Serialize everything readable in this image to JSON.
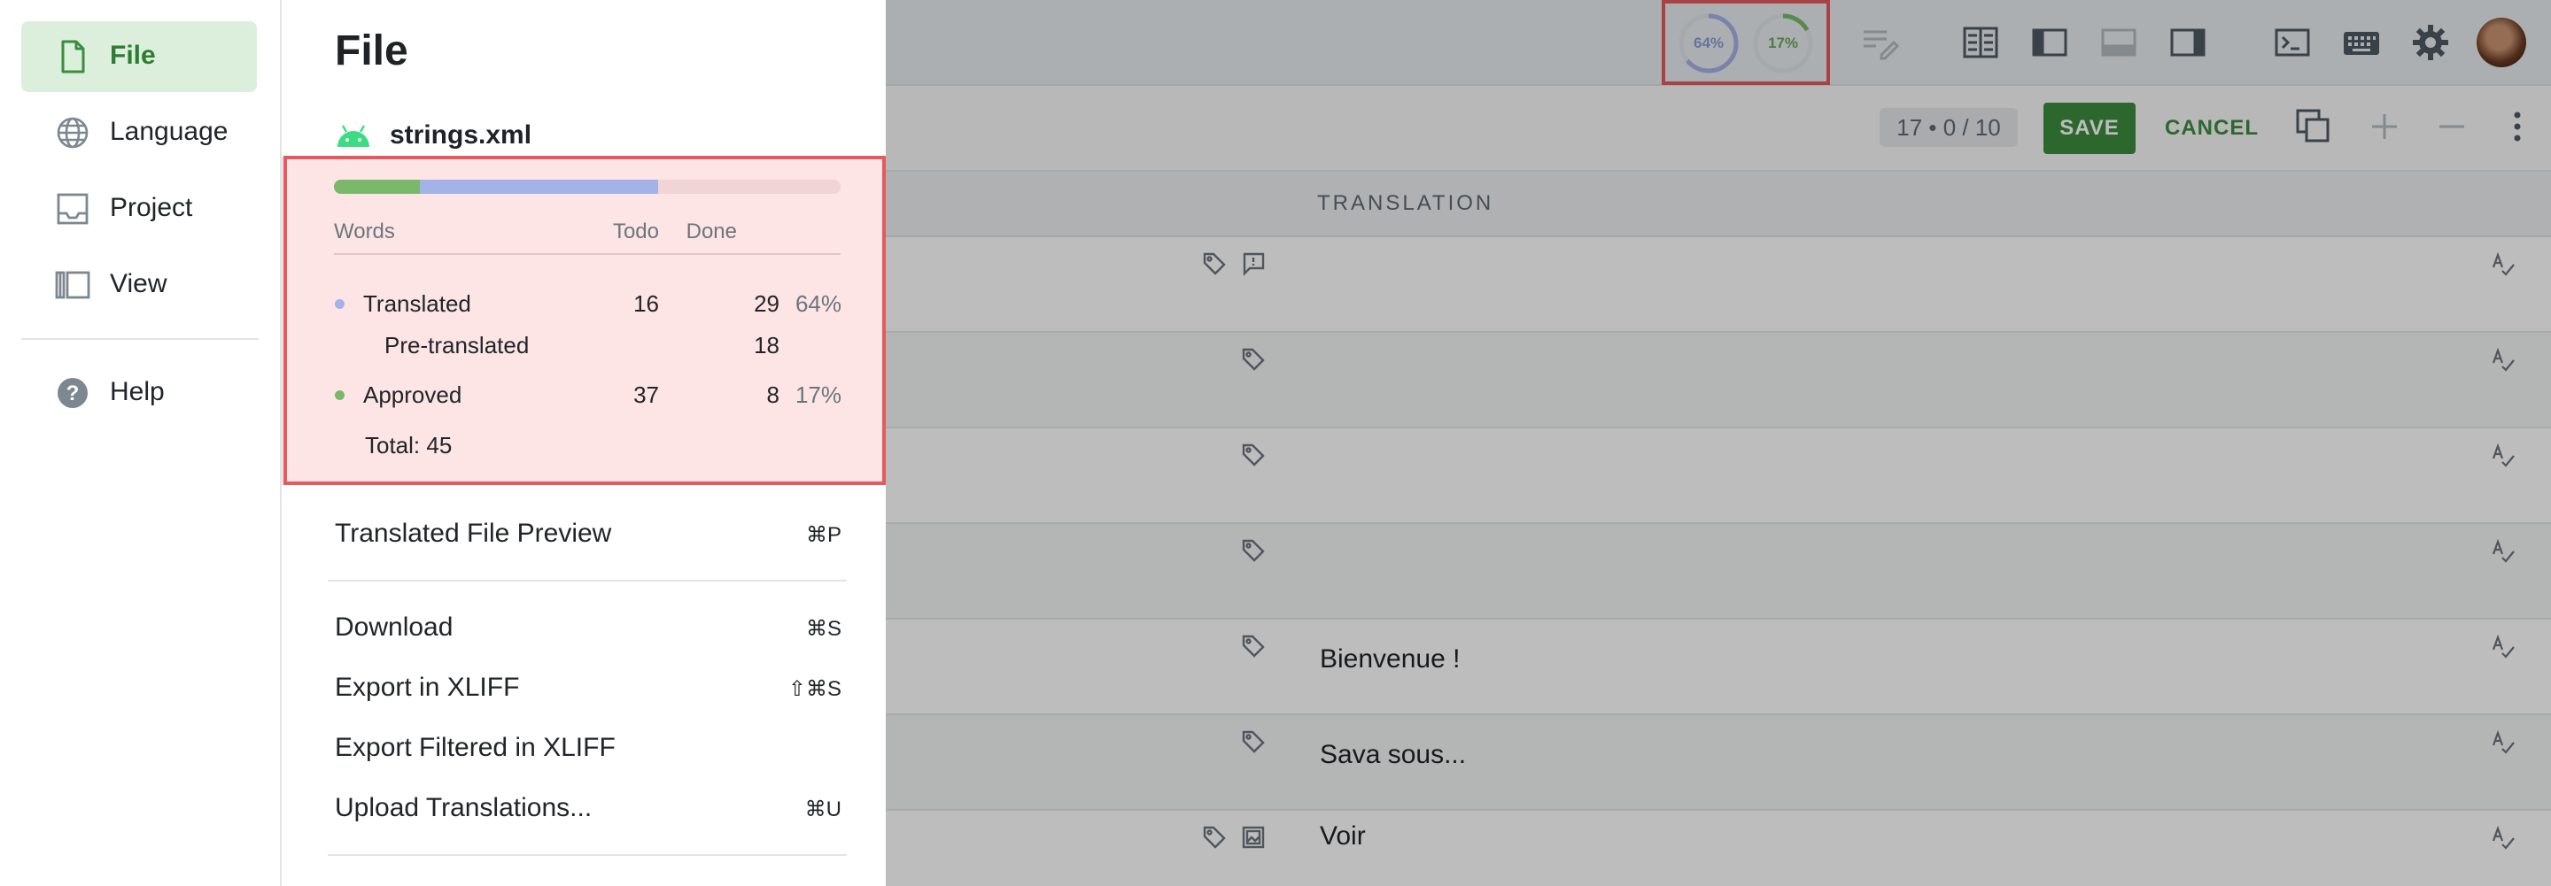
{
  "nav": {
    "items": [
      {
        "label": "File",
        "icon": "file-icon"
      },
      {
        "label": "Language",
        "icon": "globe-icon"
      },
      {
        "label": "Project",
        "icon": "inbox-icon"
      },
      {
        "label": "View",
        "icon": "view-layout-icon"
      },
      {
        "label": "Help",
        "icon": "help-icon"
      }
    ]
  },
  "panel": {
    "title": "File",
    "file_name": "strings.xml",
    "file_icon": "android-icon",
    "progress": {
      "approved": 0.17,
      "translated": 0.64
    },
    "headers": {
      "words": "Words",
      "todo": "Todo",
      "done": "Done"
    },
    "rows": {
      "translated": {
        "label": "Translated",
        "todo": "16",
        "done": "29",
        "pct": "64%"
      },
      "pretranslated": {
        "label": "Pre-translated",
        "done": "18"
      },
      "approved": {
        "label": "Approved",
        "todo": "37",
        "done": "8",
        "pct": "17%"
      }
    },
    "total": "Total: 45",
    "menu": [
      {
        "label": "Translated File Preview",
        "shortcut": "⌘P"
      },
      {
        "label": "Download",
        "shortcut": "⌘S"
      },
      {
        "label": "Export in XLIFF",
        "shortcut": "⇧⌘S"
      },
      {
        "label": "Export Filtered in XLIFF",
        "shortcut": ""
      },
      {
        "label": "Upload Translations...",
        "shortcut": "⌘U"
      }
    ]
  },
  "toolbar": {
    "translated_ring": {
      "label": "64%",
      "value": 0.64
    },
    "approved_ring": {
      "label": "17%",
      "value": 0.17
    }
  },
  "editor": {
    "counter": "17 • 0 / 10",
    "save_label": "SAVE",
    "cancel_label": "CANCEL",
    "translation_header": "TRANSLATION",
    "rows": [
      {
        "translation": ""
      },
      {
        "translation": ""
      },
      {
        "translation": ""
      },
      {
        "translation": ""
      },
      {
        "translation": "Bienvenue !"
      },
      {
        "translation": "Sava sous..."
      },
      {
        "translation": "Voir"
      }
    ]
  },
  "colors": {
    "accent_green": "#3c8c3f",
    "translated_blue": "#a3b3e8",
    "approved_green": "#7ab86a",
    "highlight_red": "#e55a5e"
  }
}
